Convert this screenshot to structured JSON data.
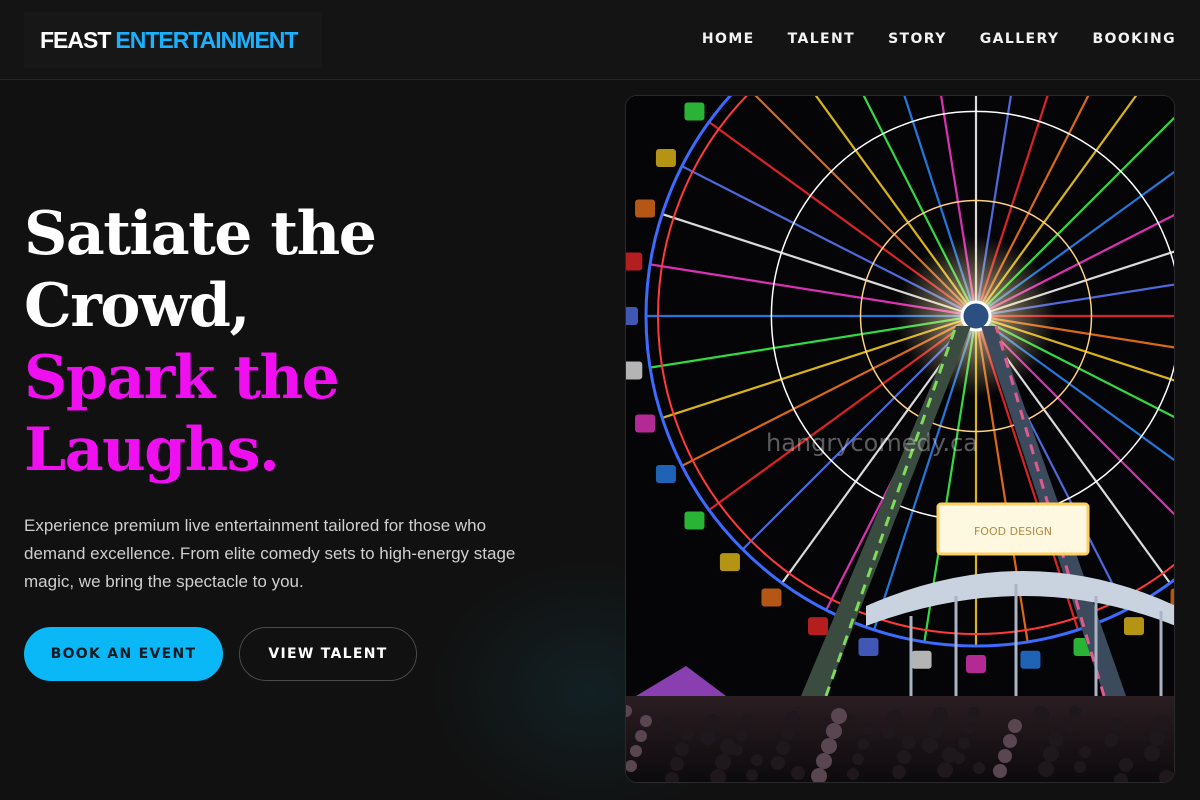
{
  "brand": {
    "name_part1": "FEAST",
    "name_part2": "ENTERTAINMENT",
    "accent_color": "#1ab2ff"
  },
  "nav": {
    "items": [
      {
        "label": "HOME"
      },
      {
        "label": "TALENT"
      },
      {
        "label": "STORY"
      },
      {
        "label": "GALLERY"
      },
      {
        "label": "BOOKING"
      }
    ]
  },
  "hero": {
    "title_lines": [
      "Satiate the",
      "Crowd,"
    ],
    "accent_lines": [
      "Spark the",
      "Laughs."
    ],
    "accent_color": "#f00ff0",
    "description": "Experience premium live entertainment tailored for those who demand excellence. From elite comedy sets to high-energy stage magic, we bring the spectacle to you.",
    "primary_button": "BOOK AN EVENT",
    "secondary_button": "VIEW TALENT",
    "primary_color": "#0ab7f7"
  },
  "image": {
    "watermark": "hangrycomedy.ca",
    "sign_text": "FOOD DESIGN"
  }
}
